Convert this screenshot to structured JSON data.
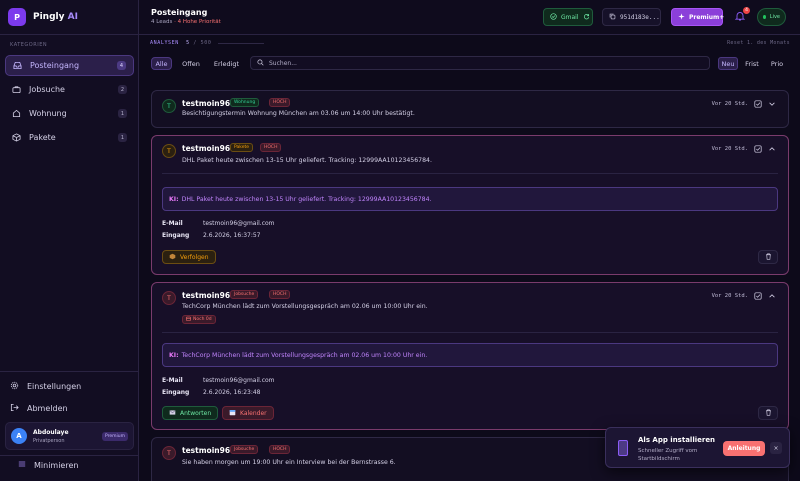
{
  "app": {
    "logo_letter": "P",
    "name": "Pingly",
    "name_accent": "AI"
  },
  "sidebar": {
    "section_label": "KATEGORIEN",
    "items": [
      {
        "label": "Posteingang",
        "count": "4",
        "icon": "inbox-icon"
      },
      {
        "label": "Jobsuche",
        "count": "2",
        "icon": "briefcase-icon"
      },
      {
        "label": "Wohnung",
        "count": "1",
        "icon": "home-icon"
      },
      {
        "label": "Pakete",
        "count": "1",
        "icon": "package-icon"
      }
    ],
    "settings_label": "Einstellungen",
    "logout_label": "Abmelden",
    "user": {
      "initial": "A",
      "name": "Abdoulaye",
      "role": "Privatperson",
      "badge": "Premium"
    },
    "collapse_label": "Minimieren"
  },
  "header": {
    "title": "Posteingang",
    "leads": "4 Leads",
    "priority": "· 4 Hohe Priorität",
    "gmail_label": "Gmail",
    "hash_label": "951d183e...",
    "premium_label": "Premium+",
    "notifications_count": "4",
    "live_label": "Live"
  },
  "toolbar": {
    "analysen_label": "ANALYSEN",
    "analysen_count": "5",
    "analysen_total": "/ 500",
    "reset_label": "Reset 1. des Monats",
    "filters": [
      "Alle",
      "Offen",
      "Erledigt"
    ],
    "search_placeholder": "Suchen...",
    "sort": [
      "Neu",
      "Frist",
      "Prio"
    ]
  },
  "cards": [
    {
      "initial": "T",
      "sender": "testmoin96",
      "category": "Wohnung",
      "priority": "HOCH",
      "text": "Besichtigungstermin Wohnung München am 03.06 um 14:00 Uhr bestätigt.",
      "time": "Vor 20 Std."
    },
    {
      "initial": "T",
      "sender": "testmoin96",
      "category": "Pakete",
      "priority": "HOCH",
      "text": "DHL Paket heute zwischen 13-15 Uhr geliefert. Tracking: 12999AA10123456784.",
      "time": "Vor 20 Std.",
      "ai_prefix": "KI:",
      "ai_text": "DHL Paket heute zwischen 13-15 Uhr geliefert. Tracking: 12999AA10123456784.",
      "email_label": "E-Mail",
      "email": "testmoin96@gmail.com",
      "received_label": "Eingang",
      "received": "2.6.2026, 16:37:57",
      "action_label": "Verfolgen"
    },
    {
      "initial": "T",
      "sender": "testmoin96",
      "category": "Jobsuche",
      "priority": "HOCH",
      "text": "TechCorp München lädt zum Vorstellungsgespräch am 02.06 um 10:00 Uhr ein.",
      "deadline": "Noch 0d",
      "time": "Vor 20 Std.",
      "ai_prefix": "KI:",
      "ai_text": "TechCorp München lädt zum Vorstellungsgespräch am 02.06 um 10:00 Uhr ein.",
      "email_label": "E-Mail",
      "email": "testmoin96@gmail.com",
      "received_label": "Eingang",
      "received": "2.6.2026, 16:23:48",
      "action_reply": "Antworten",
      "action_calendar": "Kalender"
    },
    {
      "initial": "T",
      "sender": "testmoin96",
      "category": "Jobsuche",
      "priority": "HOCH",
      "text": "Sie haben morgen um 19:00 Uhr ein Interview bei der Bernstrasse 6."
    }
  ],
  "toast": {
    "title": "Als App installieren",
    "subtitle": "Schneller Zugriff vom Startbildschirm",
    "button": "Anleitung",
    "close": "×"
  },
  "colors": {
    "accent": "#7c3aed",
    "priority_red": "#f87171",
    "success_green": "#6ee7a4",
    "wohnung_tag": "#34d399",
    "pakete_tag": "#f59e0b",
    "jobsuche_tag": "#f87171"
  }
}
